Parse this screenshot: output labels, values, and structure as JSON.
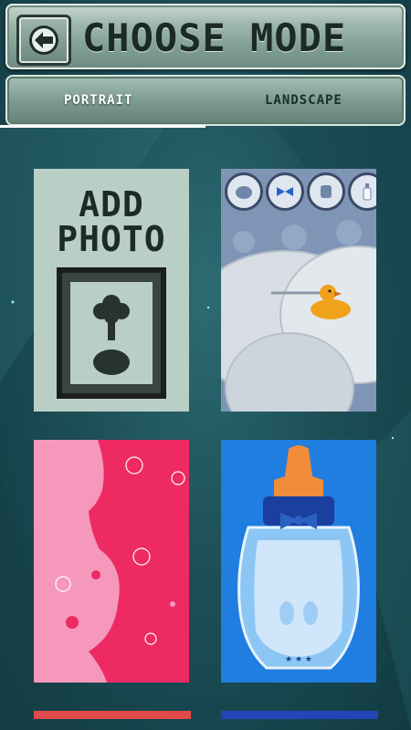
{
  "header": {
    "title": "CHOOSE MODE",
    "back_icon": "back-arrow-icon"
  },
  "tabs": [
    {
      "label": "PORTRAIT",
      "selected": true
    },
    {
      "label": "LANDSCAPE",
      "selected": false
    }
  ],
  "frames": [
    {
      "name": "add-photo",
      "line1": "ADD",
      "line2": "PHOTO",
      "icon": "photo-frame-icon"
    },
    {
      "name": "duck-frame",
      "icons": [
        "bib-icon",
        "bow-icon",
        "onesie-icon",
        "bottle-icon"
      ]
    },
    {
      "name": "pregnancy-frame"
    },
    {
      "name": "baby-bottle-frame"
    }
  ],
  "colors": {
    "accent_pink": "#ee2a63",
    "accent_blue": "#1f7ee0",
    "panel_gray": "#b9cfc5",
    "header_green": "#7e9c91"
  }
}
